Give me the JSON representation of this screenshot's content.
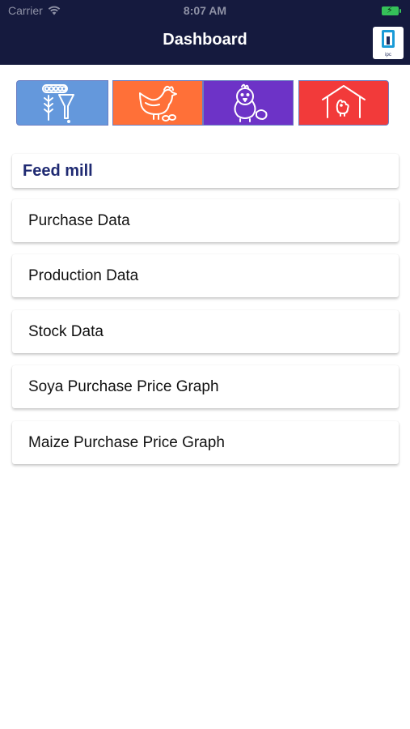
{
  "status_bar": {
    "carrier": "Carrier",
    "time": "8:07 AM"
  },
  "header": {
    "title": "Dashboard",
    "logo_text": "ipc"
  },
  "categories": [
    {
      "name": "feed-mill",
      "icon": "feed-mill-icon",
      "color": "#6498dc"
    },
    {
      "name": "breeder",
      "icon": "hen-icon",
      "color": "#ff7038"
    },
    {
      "name": "hatchery",
      "icon": "chick-icon",
      "color": "#6d33c7"
    },
    {
      "name": "farm",
      "icon": "poultry-house-icon",
      "color": "#f23a3a"
    }
  ],
  "section": {
    "title": "Feed mill"
  },
  "menu": [
    {
      "label": "Purchase Data"
    },
    {
      "label": "Production Data"
    },
    {
      "label": "Stock Data"
    },
    {
      "label": "Soya Purchase Price Graph"
    },
    {
      "label": "Maize Purchase Price Graph"
    }
  ]
}
